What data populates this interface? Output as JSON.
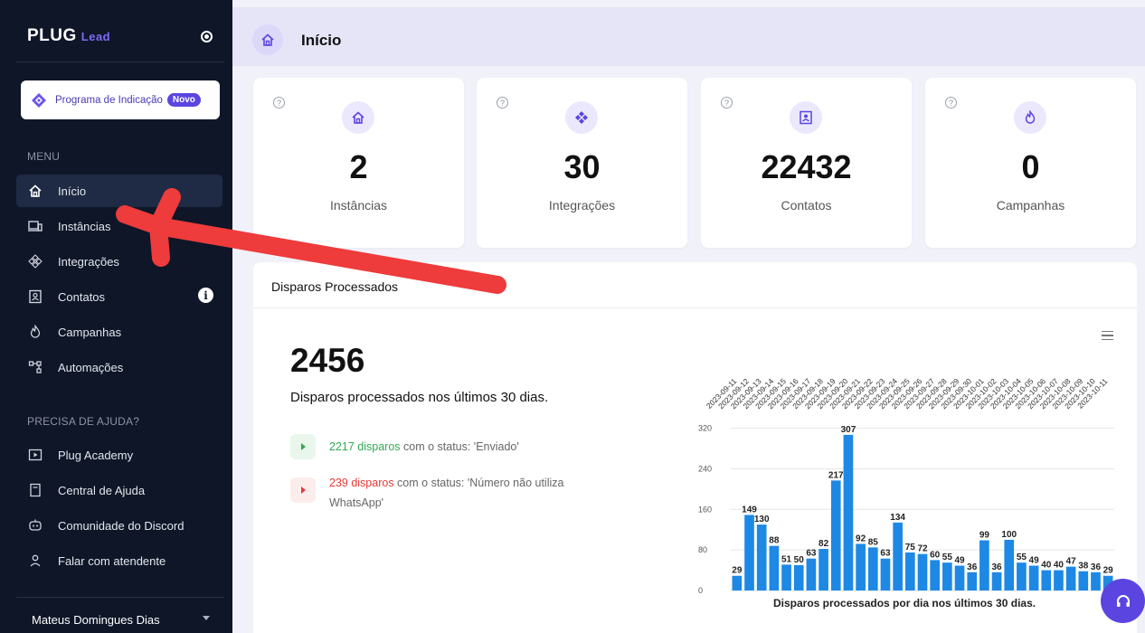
{
  "brand": {
    "name": "PLUG",
    "suffix": "Lead"
  },
  "referral": {
    "label": "Programa de Indicação",
    "badge": "Novo"
  },
  "sidebar": {
    "menu_title": "MENU",
    "items": [
      {
        "label": "Início",
        "icon": "home-icon",
        "active": true
      },
      {
        "label": "Instâncias",
        "icon": "devices-icon"
      },
      {
        "label": "Integrações",
        "icon": "integrations-icon"
      },
      {
        "label": "Contatos",
        "icon": "contacts-icon",
        "info_icon": "info-icon"
      },
      {
        "label": "Campanhas",
        "icon": "flame-icon"
      },
      {
        "label": "Automações",
        "icon": "automation-icon"
      }
    ],
    "help_title": "PRECISA DE AJUDA?",
    "help_items": [
      {
        "label": "Plug Academy",
        "icon": "play-icon"
      },
      {
        "label": "Central de Ajuda",
        "icon": "book-icon"
      },
      {
        "label": "Comunidade do Discord",
        "icon": "discord-icon"
      },
      {
        "label": "Falar com atendente",
        "icon": "user-icon"
      }
    ],
    "user": "Mateus Domingues Dias"
  },
  "header": {
    "title": "Início"
  },
  "stats": [
    {
      "value": "2",
      "label": "Instâncias",
      "icon": "home-icon"
    },
    {
      "value": "30",
      "label": "Integrações",
      "icon": "integrations-icon"
    },
    {
      "value": "22432",
      "label": "Contatos",
      "icon": "contacts-icon"
    },
    {
      "value": "0",
      "label": "Campanhas",
      "icon": "flame-icon"
    }
  ],
  "panel": {
    "title": "Disparos Processados",
    "total": "2456",
    "description": "Disparos processados nos últimos 30 dias.",
    "sent": {
      "count": "2217 disparos",
      "text": " com o status: 'Enviado'"
    },
    "failed": {
      "count": "239 disparos",
      "text": " com o status: 'Número não utiliza WhatsApp'"
    }
  },
  "colors": {
    "accent": "#5b45e0",
    "bar": "#1e88e5",
    "sidebar_bg": "#0e1628",
    "green": "#34a853",
    "red": "#e53935"
  },
  "chart_data": {
    "type": "bar",
    "title": "Disparos processados por dia nos últimos 30 dias.",
    "categories": [
      "2023-09-11",
      "2023-09-12",
      "2023-09-13",
      "2023-09-14",
      "2023-09-15",
      "2023-09-16",
      "2023-09-17",
      "2023-09-18",
      "2023-09-19",
      "2023-09-20",
      "2023-09-21",
      "2023-09-22",
      "2023-09-23",
      "2023-09-24",
      "2023-09-25",
      "2023-09-26",
      "2023-09-27",
      "2023-09-28",
      "2023-09-29",
      "2023-09-30",
      "2023-10-01",
      "2023-10-02",
      "2023-10-03",
      "2023-10-04",
      "2023-10-05",
      "2023-10-06",
      "2023-10-07",
      "2023-10-08",
      "2023-10-09",
      "2023-10-10",
      "2023-10-11"
    ],
    "values": [
      29,
      149,
      130,
      88,
      51,
      50,
      63,
      82,
      217,
      307,
      92,
      85,
      63,
      134,
      75,
      72,
      60,
      55,
      49,
      36,
      99,
      36,
      100,
      55,
      49,
      40,
      40,
      47,
      38,
      36,
      29
    ],
    "yticks": [
      0,
      80,
      160,
      240,
      320
    ],
    "ylim": [
      0,
      330
    ],
    "grid": true
  }
}
